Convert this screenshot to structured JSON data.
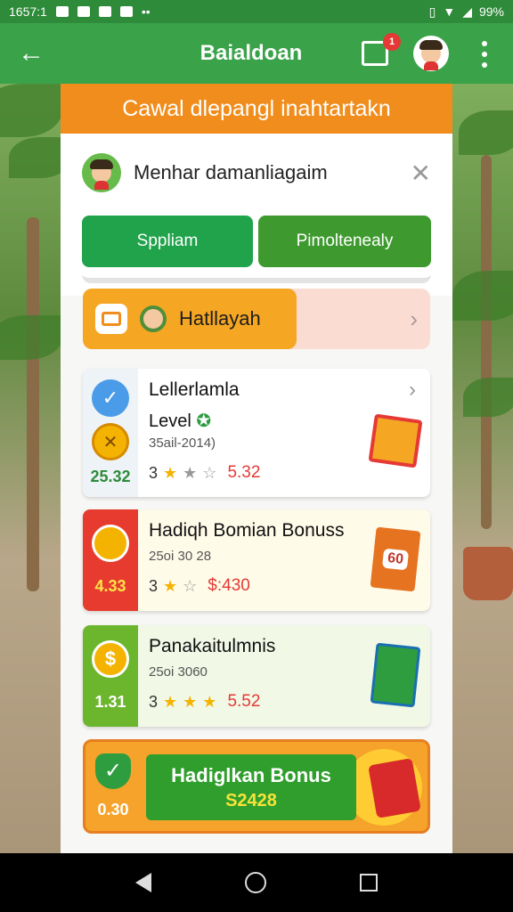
{
  "status_bar": {
    "time": "1657:1",
    "battery": "99%"
  },
  "app_bar": {
    "title": "Baialdoan",
    "badge": "1"
  },
  "banner": {
    "text": "Cawal dlepangl inahtartakn"
  },
  "profile": {
    "name": "Menhar damanliagaim"
  },
  "buttons": {
    "primary": "Sppliam",
    "secondary": "Pimoltenealy"
  },
  "feature": {
    "label": "Hatllayah"
  },
  "cards": [
    {
      "title": "Lellerlamla",
      "subtitle": "Level",
      "code": "35ail-2014)",
      "side_value": "25.32",
      "rating": "3",
      "price": "5.32"
    },
    {
      "title": "Hadiqh Bomian Bonuss",
      "code": "25oi 30 28",
      "side_value": "4.33",
      "rating": "3",
      "price": "$:430",
      "book_text": "60"
    },
    {
      "title": "Panakaitulmnis",
      "code": "25oi 3060",
      "side_value": "1.31",
      "rating": "3",
      "price": "5.52"
    }
  ],
  "bonus": {
    "title": "Hadiglkan Bonus",
    "amount": "S2428",
    "side_value": "0.30"
  },
  "colors": {
    "app_green": "#3aa34a",
    "banner_orange": "#f08d1c",
    "price_red": "#e53935"
  }
}
